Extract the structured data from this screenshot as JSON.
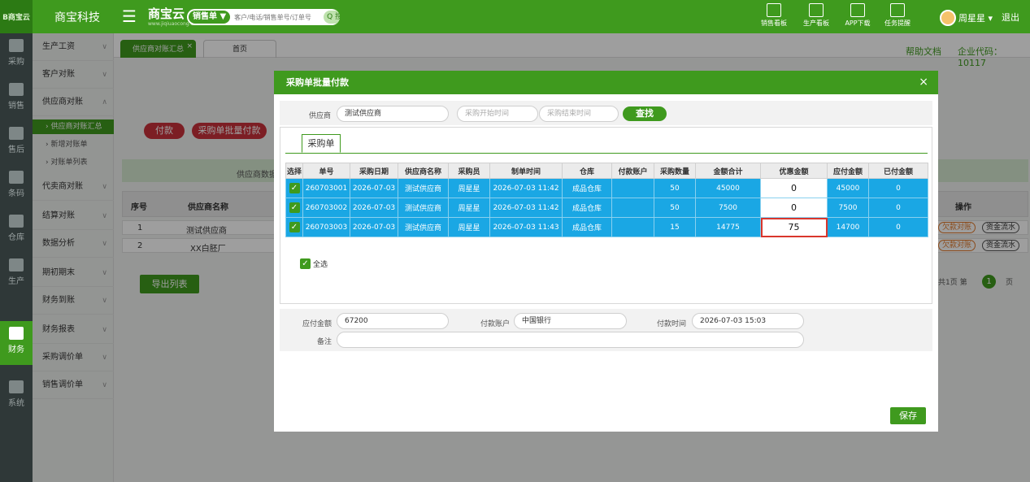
{
  "topbar": {
    "logo_text": "B商宝云",
    "company": "商宝科技",
    "brand": "商宝云",
    "brand_sub": "www.jiqiuaocong.cn",
    "search_type": "销售单 ▼",
    "search_placeholder": "客户/电话/销售单号/订单号",
    "search_button": "Q 搜索",
    "tools": [
      {
        "label": "销售看板",
        "icon": "sales-chart-icon"
      },
      {
        "label": "生产看板",
        "icon": "production-chart-icon"
      },
      {
        "label": "APP下载",
        "icon": "qrcode-icon"
      },
      {
        "label": "任务提醒",
        "icon": "flag-icon"
      }
    ],
    "user": "周星星 ▾",
    "logout": "退出"
  },
  "rail": [
    {
      "label": "采购",
      "active": false
    },
    {
      "label": "销售",
      "active": false
    },
    {
      "label": "售后",
      "active": false
    },
    {
      "label": "条码",
      "active": false
    },
    {
      "label": "仓库",
      "active": false
    },
    {
      "label": "生产",
      "active": false
    },
    {
      "label": "财务",
      "active": true
    },
    {
      "label": "系统",
      "active": false
    }
  ],
  "submenu": {
    "items": [
      "生产工资",
      "客户对账",
      "供应商对账"
    ],
    "sub_items": [
      "› 供应商对账汇总",
      "› 新增对账单",
      "› 对账单列表"
    ],
    "items_after": [
      "代卖商对账",
      "结算对账",
      "数据分析",
      "期初期末",
      "财务到账",
      "财务报表",
      "采购调价单",
      "销售调价单"
    ]
  },
  "tabs": {
    "active": "供应商对账汇总",
    "close": "×",
    "home": "首页",
    "help": "帮助文档",
    "corp": "企业代码：10117"
  },
  "background": {
    "pay_button": "付款",
    "batch_pay_button": "采购单批量付款",
    "strip_text": "供应商数据",
    "col_seq": "序号",
    "col_supplier": "供应商名称",
    "col_ops": "操作",
    "rows": [
      {
        "seq": "1",
        "name": "测试供应商"
      },
      {
        "seq": "2",
        "name": "XX白胚厂"
      }
    ],
    "pill_owed": "欠款对账",
    "pill_flow": "资金流水",
    "export": "导出列表",
    "pager_left": "共1页 第",
    "pager_num": "1",
    "pager_right": "页"
  },
  "modal": {
    "title": "采购单批量付款",
    "close": "×",
    "supplier_label": "供应商",
    "supplier_value": "测试供应商",
    "start_placeholder": "采购开始时间",
    "end_placeholder": "采购结束时间",
    "find_button": "查找",
    "tab_label": "采购单",
    "headers": [
      "选择",
      "单号",
      "采购日期",
      "供应商名称",
      "采购员",
      "制单时间",
      "仓库",
      "付款账户",
      "采购数量",
      "金额合计",
      "优惠金额",
      "应付金额",
      "已付金额"
    ],
    "rows": [
      {
        "check": "✓",
        "no": "260703001",
        "date": "2026-07-03",
        "supplier": "测试供应商",
        "buyer": "周星星",
        "created": "2026-07-03 11:42",
        "warehouse": "成品仓库",
        "account": "",
        "qty": "50",
        "total": "45000",
        "discount": "0",
        "payable": "45000",
        "paid": "0"
      },
      {
        "check": "✓",
        "no": "260703002",
        "date": "2026-07-03",
        "supplier": "测试供应商",
        "buyer": "周星星",
        "created": "2026-07-03 11:42",
        "warehouse": "成品仓库",
        "account": "",
        "qty": "50",
        "total": "7500",
        "discount": "0",
        "payable": "7500",
        "paid": "0"
      },
      {
        "check": "✓",
        "no": "260703003",
        "date": "2026-07-03",
        "supplier": "测试供应商",
        "buyer": "周星星",
        "created": "2026-07-03 11:43",
        "warehouse": "成品仓库",
        "account": "",
        "qty": "15",
        "total": "14775",
        "discount": "75",
        "payable": "14700",
        "paid": "0"
      }
    ],
    "select_all_check": "✓",
    "select_all": "全选",
    "payable_label": "应付金额",
    "payable_value": "67200",
    "account_label": "付款账户",
    "account_value": "中国银行",
    "time_label": "付款时间",
    "time_value": "2026-07-03 15:03",
    "remark_label": "备注",
    "remark_value": "",
    "save": "保存"
  }
}
